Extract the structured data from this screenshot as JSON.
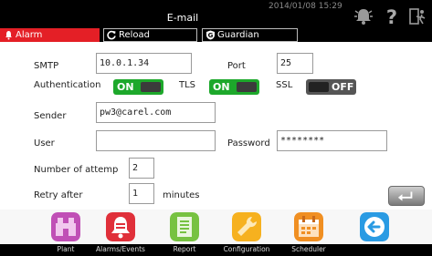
{
  "header": {
    "title": "E-mail",
    "datetime": "2014/01/08 15:29",
    "icons": [
      "alarm-bell-icon",
      "help-icon",
      "logout-icon"
    ]
  },
  "tabs": [
    {
      "label": "Alarm",
      "icon": "bell-icon",
      "active": true
    },
    {
      "label": "Reload",
      "icon": "reload-icon",
      "active": false
    },
    {
      "label": "Guardian",
      "icon": "guardian-icon",
      "active": false
    }
  ],
  "form": {
    "smtp_label": "SMTP",
    "smtp_value": "10.0.1.34",
    "port_label": "Port",
    "port_value": "25",
    "auth_label": "Authentication",
    "auth_state": "ON",
    "tls_label": "TLS",
    "tls_state": "ON",
    "ssl_label": "SSL",
    "ssl_state": "OFF",
    "sender_label": "Sender",
    "sender_value": "pw3@carel.com",
    "user_label": "User",
    "user_value": "",
    "password_label": "Password",
    "password_value": "********",
    "attempts_label": "Number of attemp",
    "attempts_value": "2",
    "retry_label": "Retry after",
    "retry_value": "1",
    "retry_unit": "minutes"
  },
  "enter_button": {
    "icon": "enter-icon"
  },
  "nav": [
    {
      "label": "Plant",
      "icon": "plant-icon",
      "color": "#c04fb6"
    },
    {
      "label": "Alarms/Events",
      "icon": "alarms-events-icon",
      "color": "#e0303a"
    },
    {
      "label": "Report",
      "icon": "report-icon",
      "color": "#77c241"
    },
    {
      "label": "Configuration",
      "icon": "configuration-icon",
      "color": "#f6b11f"
    },
    {
      "label": "Scheduler",
      "icon": "scheduler-icon",
      "color": "#f08f22"
    },
    {
      "label": "",
      "icon": "back-arrow-icon",
      "color": "#2a9be3"
    }
  ],
  "colors": {
    "alarm_tab": "#e41f26",
    "toggle_on": "#1da82b",
    "toggle_off": "#555555"
  }
}
